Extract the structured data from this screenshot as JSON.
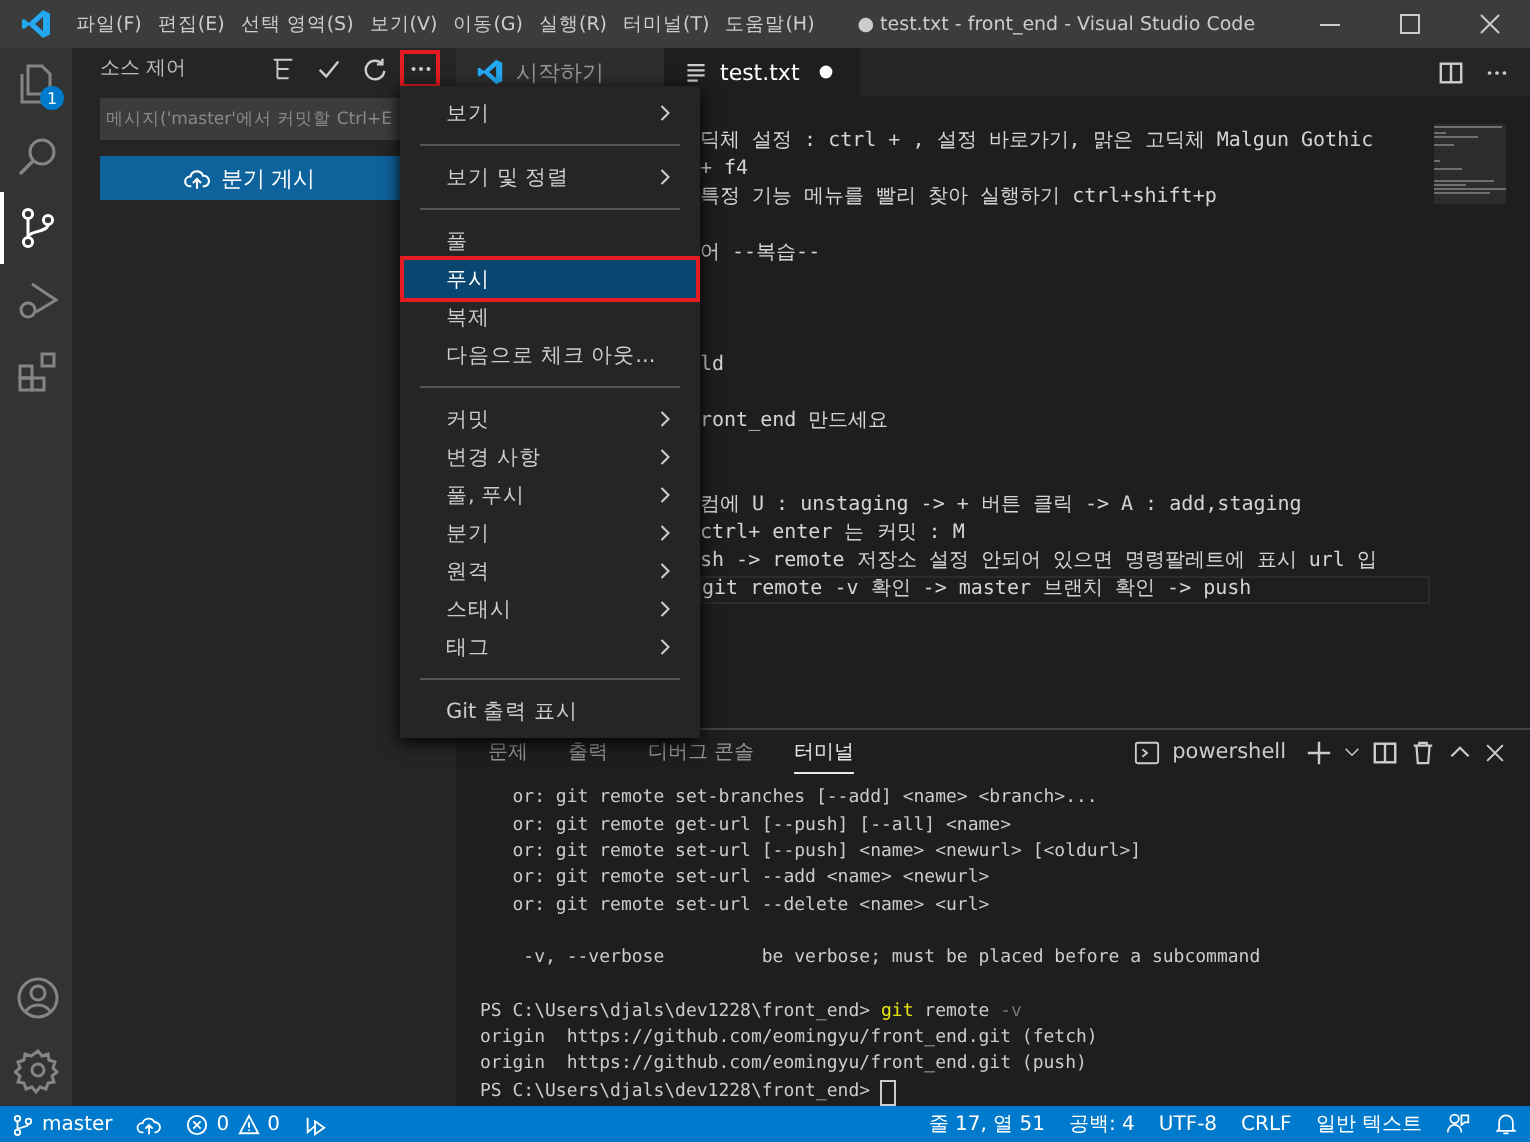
{
  "title_bar": {
    "menus": [
      "파일(F)",
      "편집(E)",
      "선택 영역(S)",
      "보기(V)",
      "이동(G)",
      "실행(R)",
      "터미널(T)",
      "도움말(H)"
    ],
    "title": "● test.txt - front_end - Visual Studio Code"
  },
  "activity_bar": {
    "items": [
      {
        "kind": "explorer",
        "selected": false,
        "badge": "1"
      },
      {
        "kind": "search",
        "selected": false
      },
      {
        "kind": "source-control",
        "selected": true
      },
      {
        "kind": "run",
        "selected": false
      },
      {
        "kind": "extensions",
        "selected": false
      }
    ],
    "bottom": [
      {
        "kind": "account"
      },
      {
        "kind": "settings"
      }
    ]
  },
  "sidebar": {
    "title": "소스 제어",
    "actions": [
      {
        "kind": "tree",
        "highlighted": false
      },
      {
        "kind": "check",
        "highlighted": false
      },
      {
        "kind": "refresh",
        "highlighted": false
      },
      {
        "kind": "more",
        "highlighted": true
      }
    ],
    "message": {
      "placeholder": "메시지('master'에서 커밋할 Ctrl+E"
    },
    "publish_button": "분기 게시"
  },
  "tabs": [
    {
      "label": "시작하기",
      "kind": "welcome",
      "selected": false,
      "dirty": false
    },
    {
      "label": "test.txt",
      "kind": "file",
      "selected": true,
      "dirty": true
    }
  ],
  "editor": {
    "lines": [
      {
        "kind": "text",
        "text": "딕체 설정 : ctrl + , 설정 바로가기, 맑은 고딕체 Malgun Gothic",
        "current": false
      },
      {
        "kind": "text",
        "text": "+ f4",
        "current": false
      },
      {
        "kind": "text",
        "text": "특정 기능 메뉴를 빨리 찾아 실행하기 ctrl+shift+p",
        "current": false
      },
      {
        "kind": "blank"
      },
      {
        "kind": "text",
        "text": "어 --복습--",
        "current": false
      },
      {
        "kind": "blank"
      },
      {
        "kind": "blank"
      },
      {
        "kind": "blank"
      },
      {
        "kind": "text",
        "text": "ld",
        "current": false
      },
      {
        "kind": "blank"
      },
      {
        "kind": "text",
        "text": "ront_end 만드세요",
        "current": false
      },
      {
        "kind": "blank"
      },
      {
        "kind": "blank"
      },
      {
        "kind": "text",
        "text": "컴에 U : unstaging -> + 버튼 클릭 -> A : add,staging",
        "current": false
      },
      {
        "kind": "text",
        "text": "ctrl+ enter 는 커밋 : M",
        "current": false
      },
      {
        "kind": "text",
        "text": "sh -> remote 저장소 설정 안되어 있으면 명령팔레트에 표시 url 입",
        "current": false
      },
      {
        "kind": "text",
        "text": "git remote -v 확인 -> master 브랜치 확인 -> push",
        "current": true
      }
    ]
  },
  "menu": {
    "items": [
      {
        "kind": "item",
        "label": "보기",
        "submenu": true,
        "selected": false,
        "highlighted": false
      },
      {
        "kind": "separator"
      },
      {
        "kind": "item",
        "label": "보기 및 정렬",
        "submenu": true,
        "selected": false,
        "highlighted": false
      },
      {
        "kind": "separator"
      },
      {
        "kind": "item",
        "label": "풀",
        "submenu": false,
        "selected": false,
        "highlighted": false
      },
      {
        "kind": "item",
        "label": "푸시",
        "submenu": false,
        "selected": true,
        "highlighted": true
      },
      {
        "kind": "item",
        "label": "복제",
        "submenu": false,
        "selected": false,
        "highlighted": false
      },
      {
        "kind": "item",
        "label": "다음으로 체크 아웃...",
        "submenu": false,
        "selected": false,
        "highlighted": false
      },
      {
        "kind": "separator"
      },
      {
        "kind": "item",
        "label": "커밋",
        "submenu": true,
        "selected": false,
        "highlighted": false
      },
      {
        "kind": "item",
        "label": "변경 사항",
        "submenu": true,
        "selected": false,
        "highlighted": false
      },
      {
        "kind": "item",
        "label": "풀, 푸시",
        "submenu": true,
        "selected": false,
        "highlighted": false
      },
      {
        "kind": "item",
        "label": "분기",
        "submenu": true,
        "selected": false,
        "highlighted": false
      },
      {
        "kind": "item",
        "label": "원격",
        "submenu": true,
        "selected": false,
        "highlighted": false
      },
      {
        "kind": "item",
        "label": "스태시",
        "submenu": true,
        "selected": false,
        "highlighted": false
      },
      {
        "kind": "item",
        "label": "태그",
        "submenu": true,
        "selected": false,
        "highlighted": false
      },
      {
        "kind": "separator"
      },
      {
        "kind": "item",
        "label": "Git 출력 표시",
        "submenu": false,
        "selected": false,
        "highlighted": false
      }
    ]
  },
  "panel": {
    "tabs": [
      {
        "label": "문제",
        "selected": false
      },
      {
        "label": "출력",
        "selected": false
      },
      {
        "label": "디버그 콘솔",
        "selected": false
      },
      {
        "label": "터미널",
        "selected": true
      }
    ],
    "terminal_name": "powershell",
    "lines": [
      {
        "kind": "text",
        "text": "   or: git remote set-branches [--add] <name> <branch>..."
      },
      {
        "kind": "text",
        "text": "   or: git remote get-url [--push] [--all] <name>"
      },
      {
        "kind": "text",
        "text": "   or: git remote set-url [--push] <name> <newurl> [<oldurl>]"
      },
      {
        "kind": "text",
        "text": "   or: git remote set-url --add <name> <newurl>"
      },
      {
        "kind": "text",
        "text": "   or: git remote set-url --delete <name> <url>"
      },
      {
        "kind": "blank"
      },
      {
        "kind": "text",
        "text": "    -v, --verbose         be verbose; must be placed before a subcommand"
      },
      {
        "kind": "blank"
      },
      {
        "kind": "command",
        "prompt": "PS C:\\Users\\djals\\dev1228\\front_end> ",
        "command": "git",
        "args": " remote ",
        "flag": "-v"
      },
      {
        "kind": "text",
        "text": "origin  https://github.com/eomingyu/front_end.git (fetch)"
      },
      {
        "kind": "text",
        "text": "origin  https://github.com/eomingyu/front_end.git (push)"
      },
      {
        "kind": "prompt",
        "prompt": "PS C:\\Users\\djals\\dev1228\\front_end> "
      }
    ]
  },
  "status_bar": {
    "branch": "master",
    "errors": "0",
    "warnings": "0",
    "right": [
      "줄 17, 열 51",
      "공백: 4",
      "UTF-8",
      "CRLF",
      "일반 텍스트"
    ]
  }
}
